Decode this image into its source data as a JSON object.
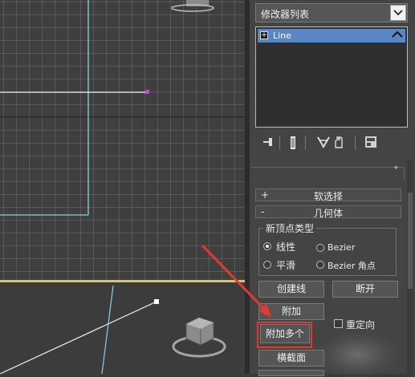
{
  "modifier_list": {
    "label": "修改器列表"
  },
  "modifier_stack": {
    "items": [
      {
        "label": "Line",
        "selected": true
      }
    ]
  },
  "stack_toolbar": {
    "icons": [
      "pin-stack-icon",
      "show-end-result-icon",
      "make-unique-icon",
      "remove-modifier-icon",
      "configure-sets-icon"
    ]
  },
  "rollouts": {
    "soft_selection": {
      "sign": "+",
      "title": "软选择"
    },
    "geometry": {
      "sign": "-",
      "title": "几何体"
    }
  },
  "new_vertex_type": {
    "title": "新顶点类型",
    "options": [
      {
        "label": "线性",
        "checked": true
      },
      {
        "label": "Bezier",
        "checked": false
      },
      {
        "label": "平滑",
        "checked": false
      },
      {
        "label": "Bezier 角点",
        "checked": false
      }
    ]
  },
  "buttons": {
    "create_line": "创建线",
    "break": "断开",
    "attach": "附加",
    "attach_multiple": "附加多个",
    "reorient": "重定向",
    "cross_section": "横截面"
  },
  "colors": {
    "highlight_box": "#e23a2f",
    "annotation_arrow": "#e23a2f",
    "viewport_active_border": "#e0c84a",
    "spline_color": "#7fd6e0",
    "selection_blue": "#5a86c6"
  }
}
